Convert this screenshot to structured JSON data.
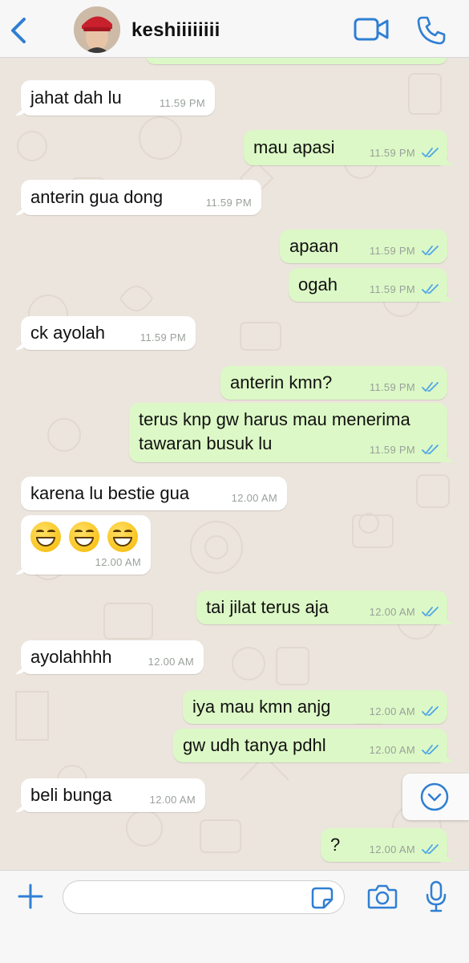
{
  "header": {
    "contact_name": "keshiiiiiiii",
    "icons": [
      "back-chevron-icon",
      "avatar",
      "video-call-icon",
      "phone-icon"
    ],
    "accent_color": "#2f7fd3"
  },
  "messages": [
    {
      "dir": "in",
      "text": "jahat dah lu",
      "time": "11.59 PM"
    },
    {
      "dir": "out",
      "text": "mau apasi",
      "time": "11.59 PM"
    },
    {
      "dir": "in",
      "text": "anterin gua dong",
      "time": "11.59 PM"
    },
    {
      "dir": "out",
      "text": "apaan",
      "time": "11.59 PM"
    },
    {
      "dir": "out",
      "text": "ogah",
      "time": "11.59 PM"
    },
    {
      "dir": "in",
      "text": "ck ayolah",
      "time": "11.59 PM"
    },
    {
      "dir": "out",
      "text": "anterin kmn?",
      "time": "11.59 PM"
    },
    {
      "dir": "out",
      "text_line1": "terus knp gw harus mau menerima",
      "text_line2": "tawaran busuk lu",
      "time": "11.59 PM"
    },
    {
      "dir": "in",
      "text": "karena lu bestie gua",
      "time": "12.00 AM"
    },
    {
      "dir": "in",
      "emoji": "grinning-face-with-smiling-eyes x3",
      "time": "12.00 AM"
    },
    {
      "dir": "out",
      "text": "tai jilat terus aja",
      "time": "12.00 AM"
    },
    {
      "dir": "in",
      "text": "ayolahhhh",
      "time": "12.00 AM"
    },
    {
      "dir": "out",
      "text": "iya mau kmn anjg",
      "time": "12.00 AM"
    },
    {
      "dir": "out",
      "text": "gw udh tanya pdhl",
      "time": "12.00 AM"
    },
    {
      "dir": "in",
      "text": "beli bunga",
      "time": "12.00 AM"
    },
    {
      "dir": "out",
      "text": "?",
      "time": "12.00 AM"
    }
  ],
  "input": {
    "placeholder": ""
  },
  "colors": {
    "incoming": "#ffffff",
    "outgoing": "#dcf8c6",
    "read_ticks": "#4fa6e8",
    "chat_bg": "#ece5dd"
  }
}
